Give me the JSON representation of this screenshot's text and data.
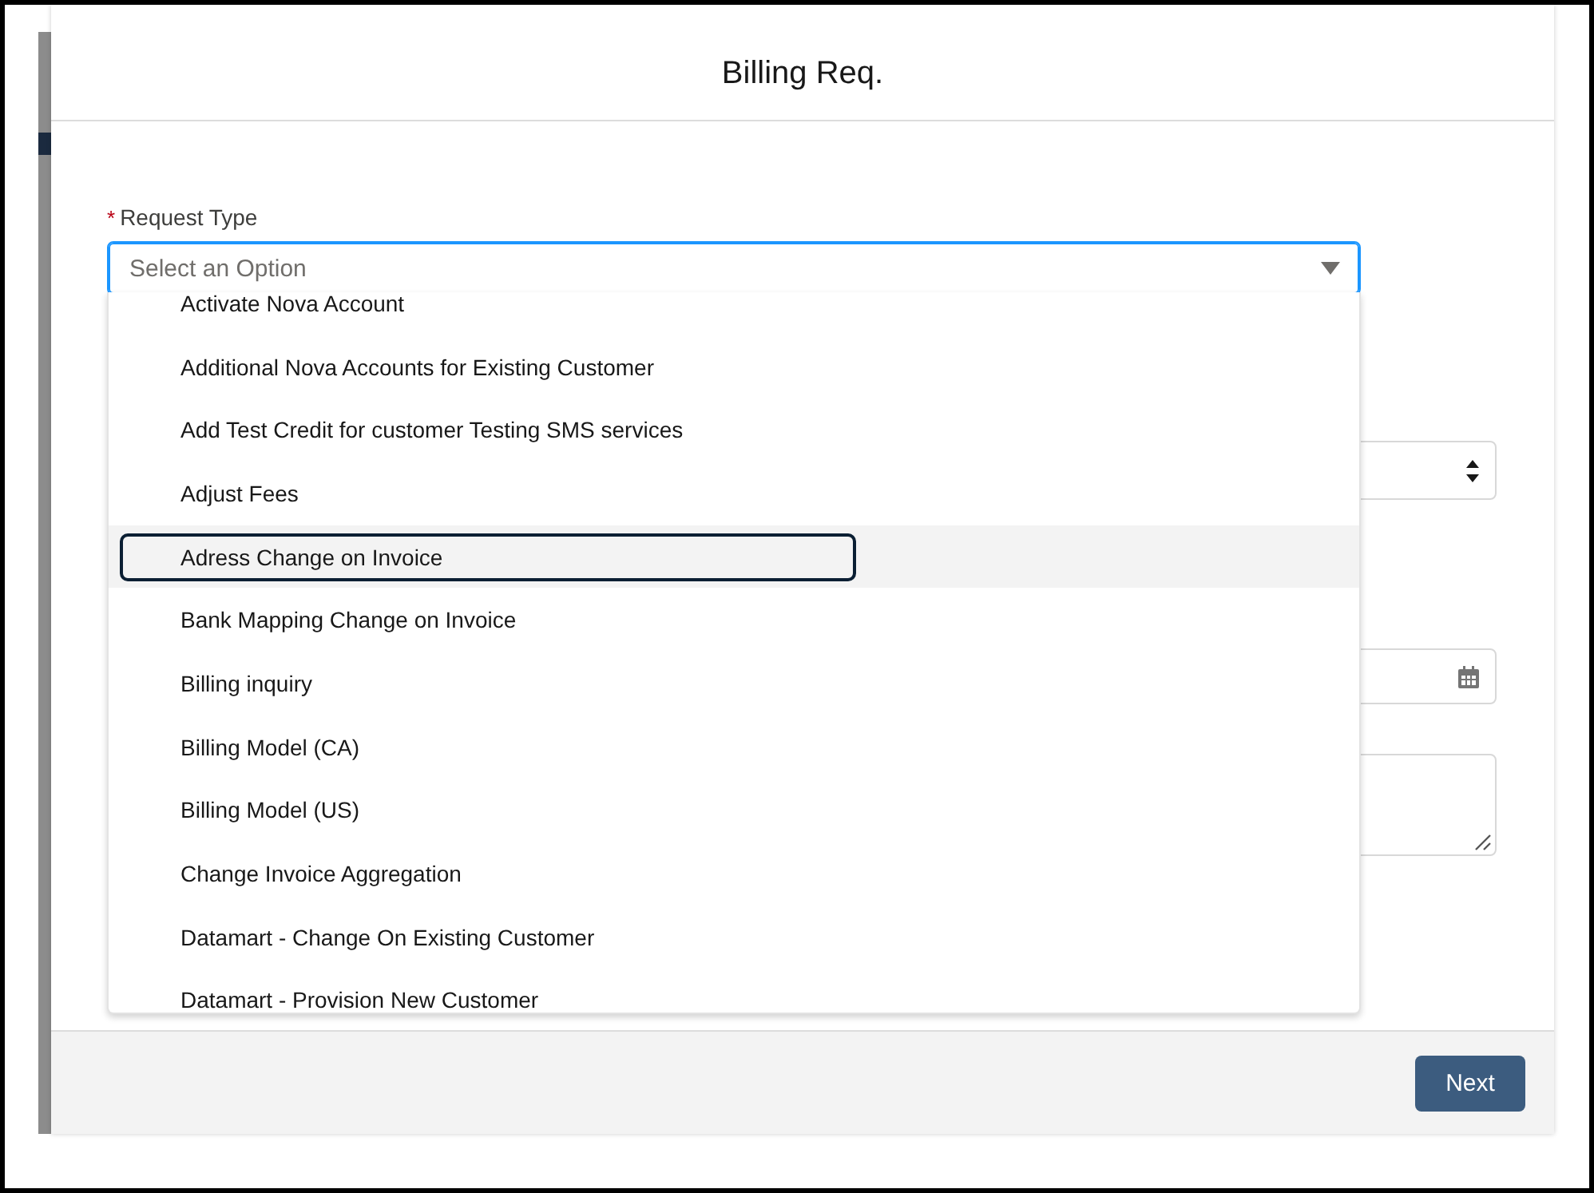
{
  "dialog": {
    "title": "Billing Req.",
    "request_type": {
      "label": "Request Type",
      "required_mark": "*",
      "placeholder": "Select an Option",
      "expanded": true,
      "options": [
        {
          "label": "Activate Nova Account",
          "selected": false
        },
        {
          "label": "Additional Nova Accounts for Existing Customer",
          "selected": false
        },
        {
          "label": "Add Test Credit for customer Testing SMS services",
          "selected": false
        },
        {
          "label": "Adjust Fees",
          "selected": false
        },
        {
          "label": "Adress Change on Invoice",
          "selected": true
        },
        {
          "label": "Bank Mapping Change on Invoice",
          "selected": false
        },
        {
          "label": "Billing inquiry",
          "selected": false
        },
        {
          "label": "Billing Model (CA)",
          "selected": false
        },
        {
          "label": "Billing Model (US)",
          "selected": false
        },
        {
          "label": "Change Invoice Aggregation",
          "selected": false
        },
        {
          "label": "Datamart - Change On Existing Customer",
          "selected": false
        },
        {
          "label": "Datamart - Provision New Customer",
          "selected": false
        }
      ]
    },
    "next_button": "Next"
  }
}
